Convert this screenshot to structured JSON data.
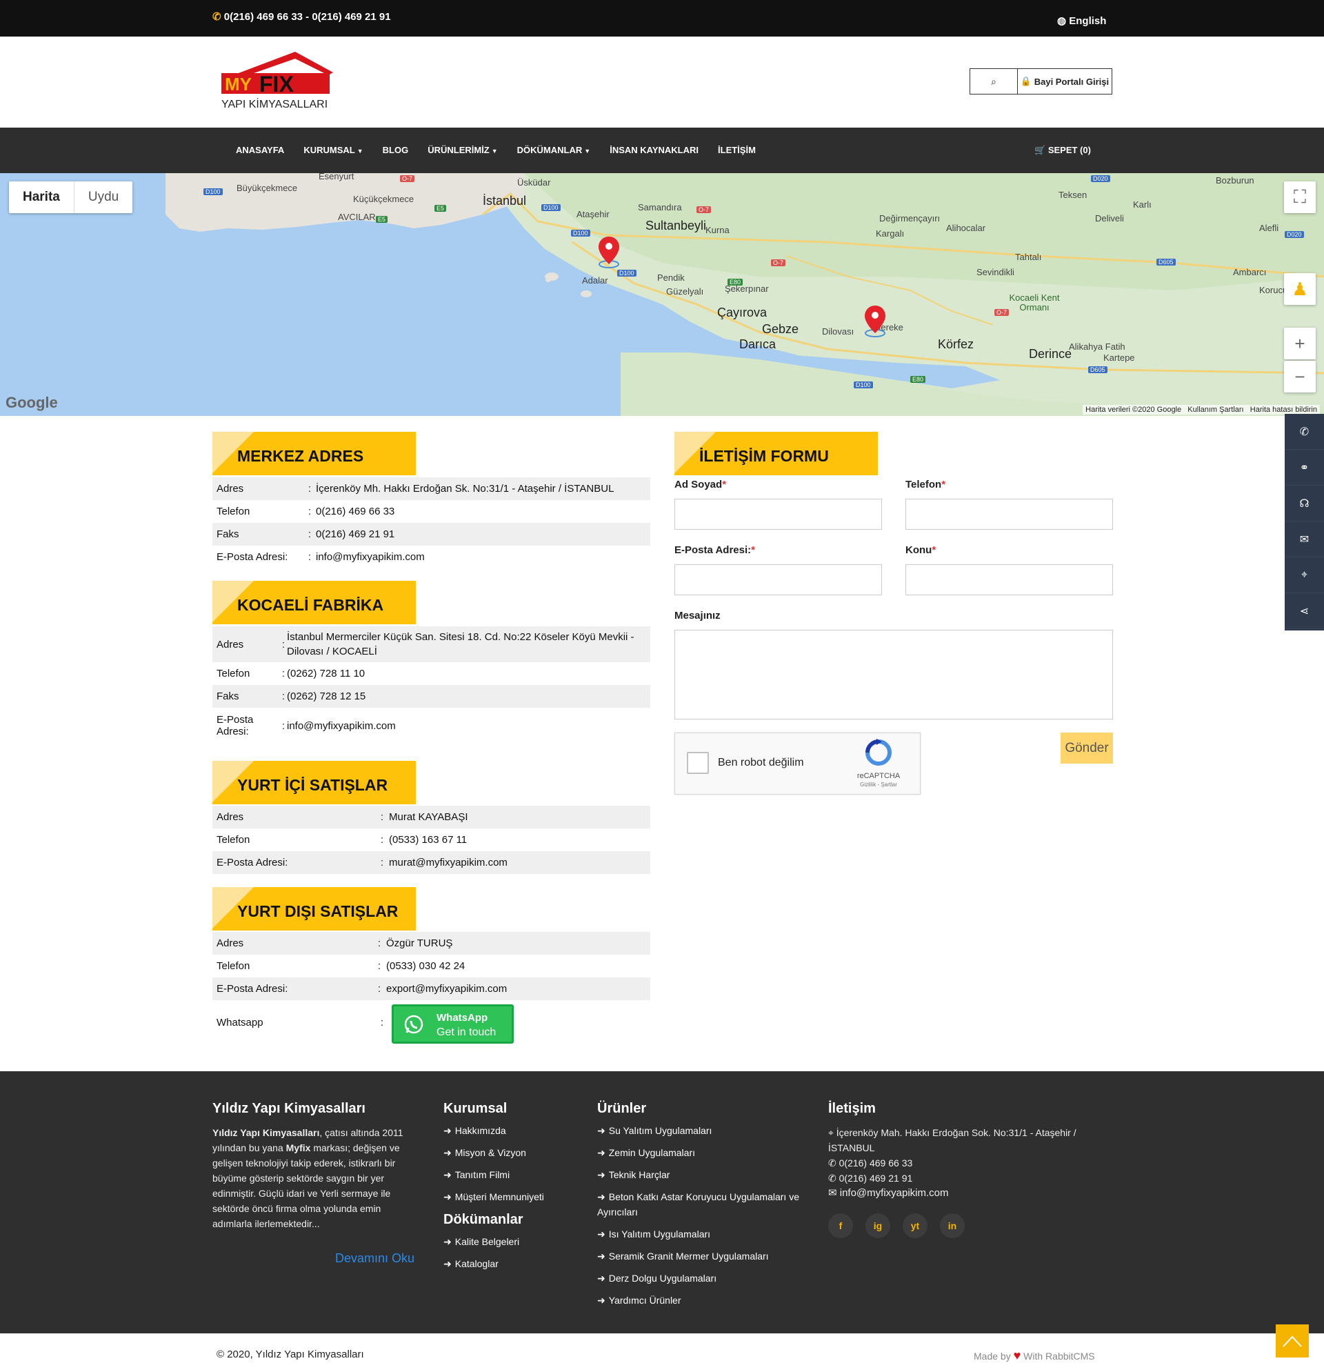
{
  "topbar": {
    "phone": "0(216) 469 66 33 - 0(216) 469 21 91",
    "language": "English"
  },
  "header": {
    "logo_brand_my": "MY",
    "logo_brand_fix": "FIX",
    "logo_sub": "YAPI KİMYASALLARI",
    "portal_label": "Bayi Portalı Girişi"
  },
  "nav": {
    "items": [
      "ANASAYFA",
      "KURUMSAL",
      "BLOG",
      "ÜRÜNLERİMİZ",
      "DÖKÜMANLAR",
      "İNSAN KAYNAKLARI",
      "İLETİŞİM"
    ],
    "dropdown_flags": [
      false,
      true,
      false,
      true,
      true,
      false,
      false
    ],
    "cart": "SEPET (0)"
  },
  "map": {
    "type_map": "Harita",
    "type_satellite": "Uydu",
    "labels": [
      "Büyükçekmece",
      "Esenyurt",
      "Küçükçekmece",
      "AVCILAR",
      "İstanbul",
      "Üsküdar",
      "Ataşehir",
      "Samandıra",
      "Sultanbeyli",
      "Kurna",
      "Değirmençayırı",
      "Alihocalar",
      "Kargalı",
      "Teksen",
      "Deliveli",
      "Karlı",
      "Bozburun",
      "Alefli",
      "Ambarcı",
      "Korucuk",
      "Tahtalı",
      "Sevindikli",
      "Kocaeli Kent Ormanı",
      "Adalar",
      "Pendik",
      "Güzelyalı",
      "Şekerpınar",
      "Çayırova",
      "Gebze",
      "Darıca",
      "Dilovası",
      "Hereke",
      "Körfez",
      "Derince",
      "Alikahya Fatih",
      "Kartepe"
    ],
    "attribution": "Harita verileri ©2020 Google",
    "terms": "Kullanım Şartları",
    "report": "Harita hatası bildirin",
    "google": "Google"
  },
  "merkez": {
    "title": "MERKEZ ADRES",
    "rows": [
      {
        "k": "Adres",
        "v": "İçerenköy Mh. Hakkı Erdoğan Sk. No:31/1 - Ataşehir / İSTANBUL"
      },
      {
        "k": "Telefon",
        "v": "0(216) 469 66 33"
      },
      {
        "k": "Faks",
        "v": "0(216) 469 21 91"
      },
      {
        "k": "E-Posta Adresi:",
        "v": "info@myfixyapikim.com"
      }
    ]
  },
  "fabrika": {
    "title": "KOCAELİ FABRİKA",
    "rows": [
      {
        "k": "Adres",
        "v": "İstanbul Mermerciler Küçük San. Sitesi 18. Cd. No:22 Köseler Köyü Mevkii - Dilovası / KOCAELİ"
      },
      {
        "k": "Telefon",
        "v": "(0262) 728 11 10"
      },
      {
        "k": "Faks",
        "v": "(0262) 728 12 15"
      },
      {
        "k": "E-Posta Adresi:",
        "v": "info@myfixyapikim.com"
      }
    ]
  },
  "yurtici": {
    "title": "YURT İÇİ SATIŞLAR",
    "rows": [
      {
        "k": "Adres",
        "v": "Murat KAYABAŞI"
      },
      {
        "k": "Telefon",
        "v": "(0533) 163 67 11"
      },
      {
        "k": "E-Posta Adresi:",
        "v": "murat@myfixyapikim.com"
      }
    ]
  },
  "yurtdisi": {
    "title": "YURT DIŞI SATIŞLAR",
    "rows": [
      {
        "k": "Adres",
        "v": "Özgür TURUŞ"
      },
      {
        "k": "Telefon",
        "v": "(0533) 030 42 24"
      },
      {
        "k": "E-Posta Adresi:",
        "v": "export@myfixyapikim.com"
      }
    ],
    "whatsapp_label": "Whatsapp",
    "wa_line1": "WhatsApp",
    "wa_line2": "Get in touch"
  },
  "colon": ":",
  "form": {
    "title": "İLETİŞİM FORMU",
    "name": "Ad Soyad",
    "phone": "Telefon",
    "email": "E-Posta Adresi:",
    "subject": "Konu",
    "message": "Mesajınız",
    "required": "*",
    "captcha_text": "Ben robot değilim",
    "captcha_brand": "reCAPTCHA",
    "captcha_links": "Gizlilik - Şartlar",
    "submit": "Gönder"
  },
  "footer": {
    "about_title": "Yıldız Yapı Kimyasalları",
    "about_bold1": "Yıldız Yapı Kimyasalları",
    "about_t1": ", çatısı altında 2011 yılından bu yana ",
    "about_bold2": "Myfix",
    "about_t2": " markası; değişen ve gelişen teknolojiyi takip ederek, istikrarlı bir büyüme gösterip sektörde saygın bir yer edinmiştir. Güçlü idari ve Yerli sermaye ile sektörde öncü firma olma yolunda emin adımlarla ilerlemektedir...",
    "read_more": "Devamını Oku",
    "kurumsal_title": "Kurumsal",
    "kurumsal": [
      "Hakkımızda",
      "Misyon & Vizyon",
      "Tanıtım Filmi",
      "Müşteri Memnuniyeti"
    ],
    "docs_title": "Dökümanlar",
    "docs": [
      "Kalite Belgeleri",
      "Kataloglar"
    ],
    "urunler_title": "Ürünler",
    "urunler": [
      "Su Yalıtım Uygulamaları",
      "Zemin Uygulamaları",
      "Teknik Harçlar",
      "Beton Katkı Astar Koruyucu Uygulamaları ve Ayırıcıları",
      "Isı Yalıtım Uygulamaları",
      "Seramik Granit Mermer Uygulamaları",
      "Derz Dolgu Uygulamaları",
      "Yardımcı Ürünler"
    ],
    "iletisim_title": "İletişim",
    "addr": "İçerenköy Mah. Hakkı Erdoğan Sok. No:31/1 - Ataşehir / İSTANBUL",
    "tel1": "0(216) 469 66 33",
    "tel2": "0(216) 469 21 91",
    "mail": "info@myfixyapikim.com",
    "social": [
      "f",
      "ig",
      "yt",
      "in"
    ]
  },
  "bottom": {
    "copyright": "© 2020, Yıldız Yapı Kimyasalları",
    "made_by": "Made by",
    "with": "With RabbitCMS"
  },
  "colors": {
    "accent": "#fec20b",
    "dark": "#2e2e2e",
    "footer": "#2f2f2f",
    "whatsapp": "#2fc256",
    "link": "#2a8ae8"
  }
}
